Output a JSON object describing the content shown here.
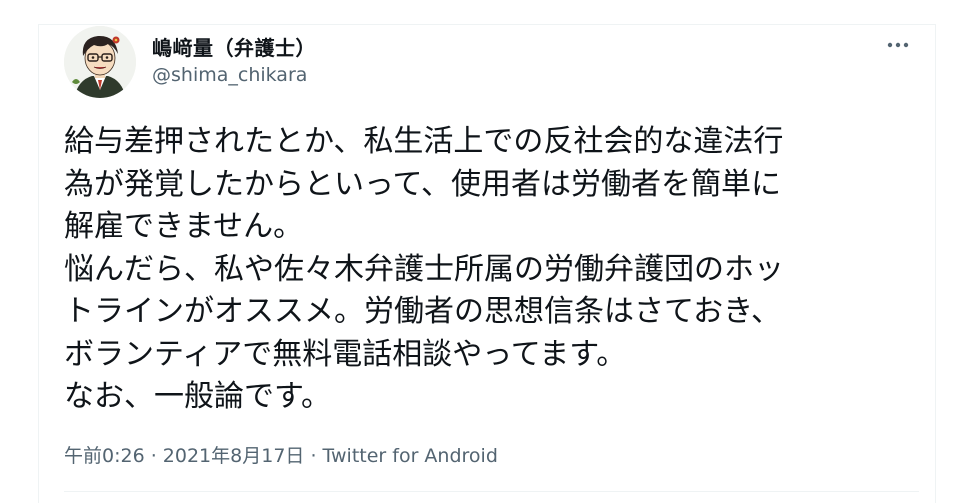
{
  "author": {
    "display_name": "嶋﨑量（弁護士）",
    "handle": "@shima_chikara",
    "avatar_icon": "avatar-illustration-icon"
  },
  "more_icon": "more-horizontal-icon",
  "tweet": {
    "text": "給与差押されたとか、私生活上での反社会的な違法行\n為が発覚したからといって、使用者は労働者を簡単に\n解雇できません。\n悩んだら、私や佐々木弁護士所属の労働弁護団のホッ\nトラインがオススメ。労働者の思想信条はさておき、\nボランティアで無料電話相談やってます。\nなお、一般論です。"
  },
  "meta": {
    "time": "午前0:26",
    "separator": " · ",
    "date": "2021年8月17日",
    "source": "Twitter for Android"
  },
  "colors": {
    "text": "#0f1419",
    "secondary": "#536471",
    "border": "#eff3f4"
  }
}
